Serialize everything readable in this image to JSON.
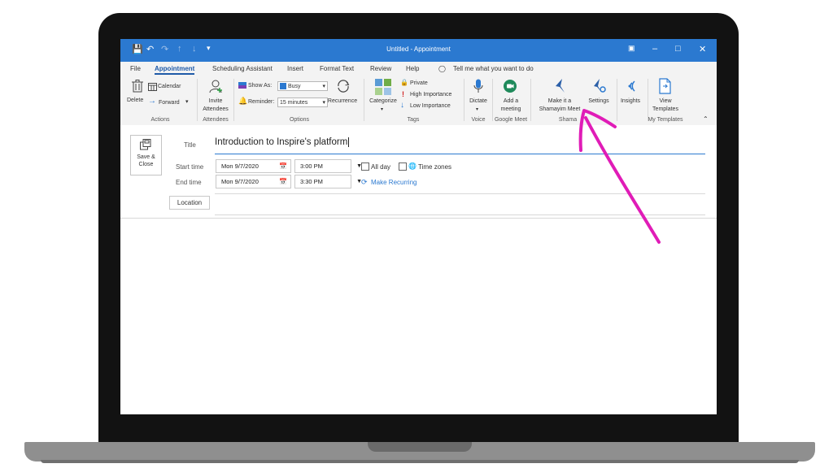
{
  "window": {
    "title": "Untitled - Appointment"
  },
  "menu": {
    "tabs": [
      "File",
      "Appointment",
      "Scheduling Assistant",
      "Insert",
      "Format Text",
      "Review",
      "Help"
    ],
    "tell_me": "Tell me what you want to do"
  },
  "ribbon": {
    "actions": {
      "delete": "Delete",
      "calendar": "Calendar",
      "forward": "Forward",
      "group": "Actions"
    },
    "attendees": {
      "invite_line1": "Invite",
      "invite_line2": "Attendees",
      "group": "Attendees"
    },
    "options": {
      "show_as_label": "Show As:",
      "show_as_value": "Busy",
      "reminder_label": "Reminder:",
      "reminder_value": "15 minutes",
      "recurrence": "Recurrence",
      "group": "Options"
    },
    "tags": {
      "categorize": "Categorize",
      "private": "Private",
      "high_importance": "High Importance",
      "low_importance": "Low Importance",
      "group": "Tags"
    },
    "voice": {
      "dictate": "Dictate",
      "group": "Voice"
    },
    "google_meet": {
      "line1": "Add a",
      "line2": "meeting",
      "group": "Google Meet"
    },
    "shamayim": {
      "make_line1": "Make it a",
      "make_line2": "Shamayim Meet",
      "settings": "Settings",
      "group": "Shama"
    },
    "insights": "Insights",
    "templates": {
      "line1": "View",
      "line2": "Templates",
      "group": "My Templates"
    }
  },
  "form": {
    "save_close_line1": "Save &",
    "save_close_line2": "Close",
    "title_label": "Title",
    "title_value": "Introduction to Inspire's platform",
    "start_label": "Start time",
    "start_date": "Mon 9/7/2020",
    "start_time": "3:00 PM",
    "end_label": "End time",
    "end_date": "Mon 9/7/2020",
    "end_time": "3:30 PM",
    "all_day": "All day",
    "time_zones": "Time zones",
    "make_recurring": "Make Recurring",
    "location": "Location"
  },
  "colors": {
    "titlebar": "#2b79d0",
    "accent": "#1f5aa8",
    "annotation_arrow": "#e01cb7"
  }
}
